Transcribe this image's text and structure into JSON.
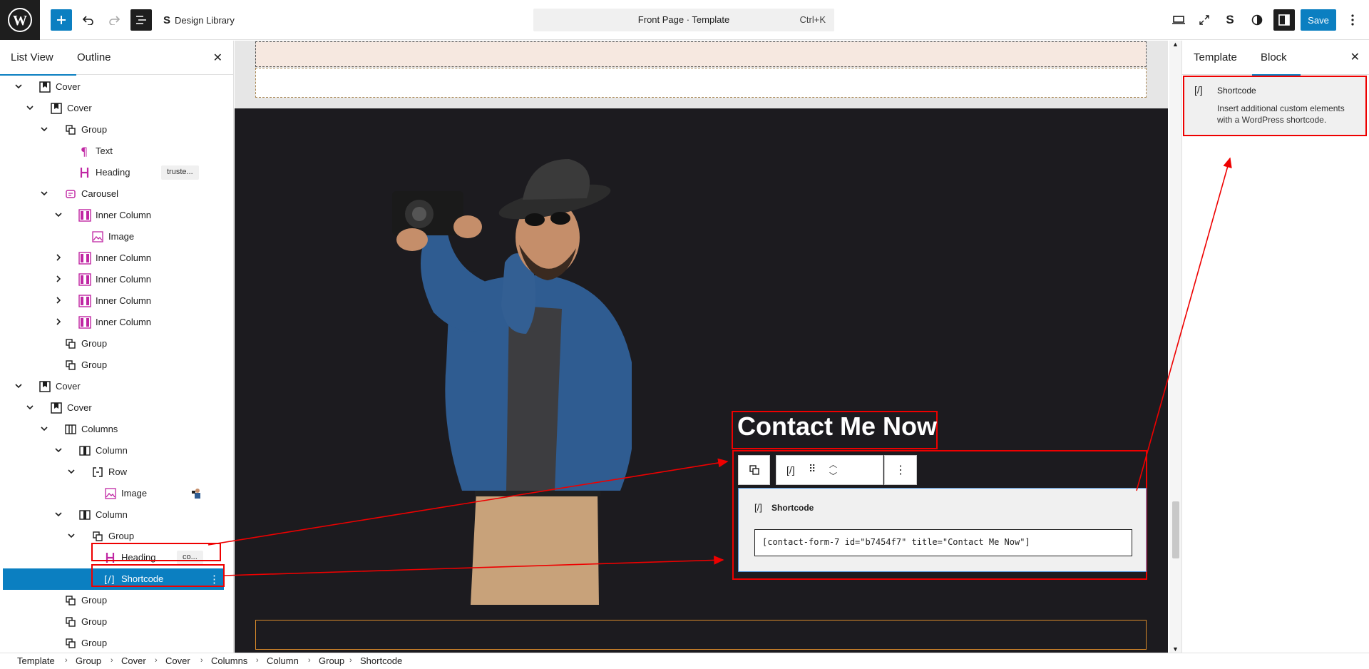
{
  "topbar": {
    "design_library": "Design Library",
    "doc_title": "Front Page · Template",
    "shortcut": "Ctrl+K",
    "save": "Save"
  },
  "left_panel": {
    "tabs": [
      "List View",
      "Outline"
    ],
    "tree": [
      {
        "label": "Cover",
        "icon": "cover-icon",
        "chev": "down"
      },
      {
        "label": "Cover",
        "icon": "cover-icon",
        "chev": "down"
      },
      {
        "label": "Group",
        "icon": "group-icon",
        "chev": "down"
      },
      {
        "label": "Text",
        "icon": "paragraph-icon",
        "chev": ""
      },
      {
        "label": "Heading",
        "icon": "heading-icon",
        "chev": "",
        "badge": "truste..."
      },
      {
        "label": "Carousel",
        "icon": "carousel-icon",
        "chev": "down"
      },
      {
        "label": "Inner Column",
        "icon": "inner-column-icon",
        "chev": "down"
      },
      {
        "label": "Image",
        "icon": "image-icon",
        "chev": ""
      },
      {
        "label": "Inner Column",
        "icon": "inner-column-icon",
        "chev": "right"
      },
      {
        "label": "Inner Column",
        "icon": "inner-column-icon",
        "chev": "right"
      },
      {
        "label": "Inner Column",
        "icon": "inner-column-icon",
        "chev": "right"
      },
      {
        "label": "Inner Column",
        "icon": "inner-column-icon",
        "chev": "right"
      },
      {
        "label": "Group",
        "icon": "group-icon",
        "chev": ""
      },
      {
        "label": "Group",
        "icon": "group-icon",
        "chev": ""
      },
      {
        "label": "Cover",
        "icon": "cover-icon",
        "chev": "down"
      },
      {
        "label": "Cover",
        "icon": "cover-icon",
        "chev": "down"
      },
      {
        "label": "Columns",
        "icon": "columns-icon",
        "chev": "down"
      },
      {
        "label": "Column",
        "icon": "column-icon",
        "chev": "down"
      },
      {
        "label": "Row",
        "icon": "row-icon",
        "chev": "down"
      },
      {
        "label": "Image",
        "icon": "image-icon",
        "chev": "",
        "thumb": true
      },
      {
        "label": "Column",
        "icon": "column-icon",
        "chev": "down"
      },
      {
        "label": "Group",
        "icon": "group-icon",
        "chev": "down"
      },
      {
        "label": "Heading",
        "icon": "heading-icon",
        "chev": "",
        "badge": "co..."
      },
      {
        "label": "Shortcode",
        "icon": "shortcode-icon",
        "chev": "",
        "selected": true
      },
      {
        "label": "Group",
        "icon": "group-icon",
        "chev": ""
      },
      {
        "label": "Group",
        "icon": "group-icon",
        "chev": ""
      },
      {
        "label": "Group",
        "icon": "group-icon",
        "chev": ""
      }
    ]
  },
  "canvas": {
    "heading": "Contact Me Now",
    "shortcode_block_title": "Shortcode",
    "shortcode_value": "[contact-form-7 id=\"b7454f7\" title=\"Contact Me Now\"]"
  },
  "right_panel": {
    "tabs": [
      "Template",
      "Block"
    ],
    "block_name": "Shortcode",
    "block_description": "Insert additional custom elements with a WordPress shortcode."
  },
  "breadcrumbs": [
    "Template",
    "Group",
    "Cover",
    "Cover",
    "Columns",
    "Column",
    "Group",
    "Shortcode"
  ],
  "colors": {
    "accent": "#0b7fc1",
    "annotation": "#e00000",
    "dark_bg": "#1c1b1f"
  }
}
